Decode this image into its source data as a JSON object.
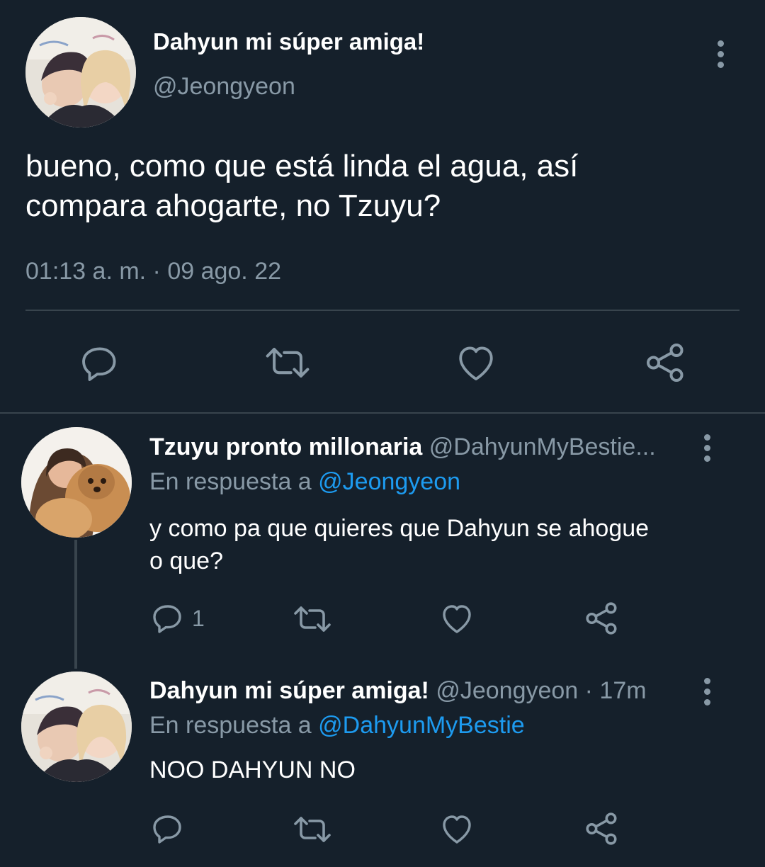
{
  "main_tweet": {
    "display_name": "Dahyun mi súper amiga!",
    "handle": "@Jeongyeon",
    "text_line1": "bueno, como que está linda el agua, así",
    "text_line2": "compara ahogarte, no Tzuyu?",
    "timestamp": "01:13 a. m. · 09 ago. 22"
  },
  "reply1": {
    "display_name": "Tzuyu pronto millonaria",
    "handle": "@DahyunMyBestie...",
    "reply_prefix": "En respuesta a",
    "reply_to": "@Jeongyeon",
    "text_line1": "y como pa que quieres que Dahyun se ahogue",
    "text_line2": "o que?",
    "reply_count": "1"
  },
  "reply2": {
    "display_name": "Dahyun mi súper amiga!",
    "handle_time": "@Jeongyeon · 17m",
    "reply_prefix": "En respuesta a",
    "reply_to": "@DahyunMyBestie",
    "text": "NOO DAHYUN NO"
  },
  "colors": {
    "background": "#15202b",
    "muted": "#8899a6",
    "link": "#1d9bf0",
    "divider": "#38444d"
  },
  "icons": [
    "reply-icon",
    "retweet-icon",
    "like-icon",
    "share-icon",
    "more-options-icon"
  ]
}
